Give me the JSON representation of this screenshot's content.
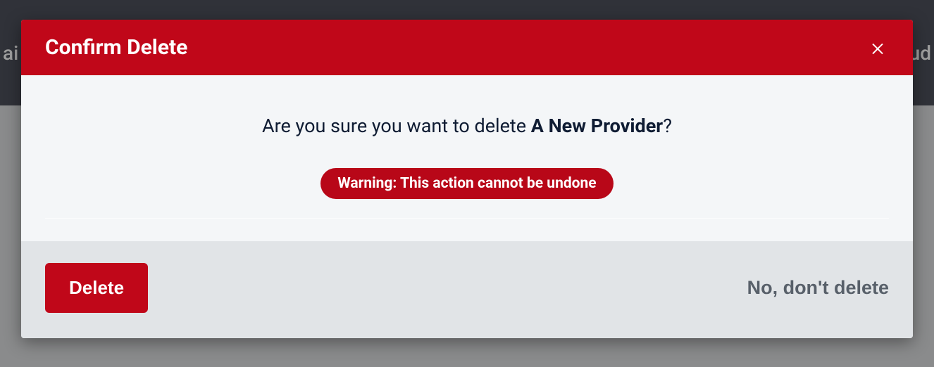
{
  "background": {
    "nav_left_fragment": "ai",
    "nav_right_fragment": "ud"
  },
  "modal": {
    "title": "Confirm Delete",
    "confirm_prefix": "Are you sure you want to delete ",
    "confirm_subject": "A New Provider",
    "confirm_suffix": "?",
    "warning_label": "Warning: This action cannot be undone",
    "delete_button_label": "Delete",
    "cancel_button_label": "No, don't delete"
  },
  "colors": {
    "danger": "#c00719",
    "danger_dark": "#b80718",
    "body_bg": "#f4f6f8",
    "footer_bg": "#e1e4e7",
    "text_dark": "#0f1c33",
    "text_muted": "#58606a"
  }
}
